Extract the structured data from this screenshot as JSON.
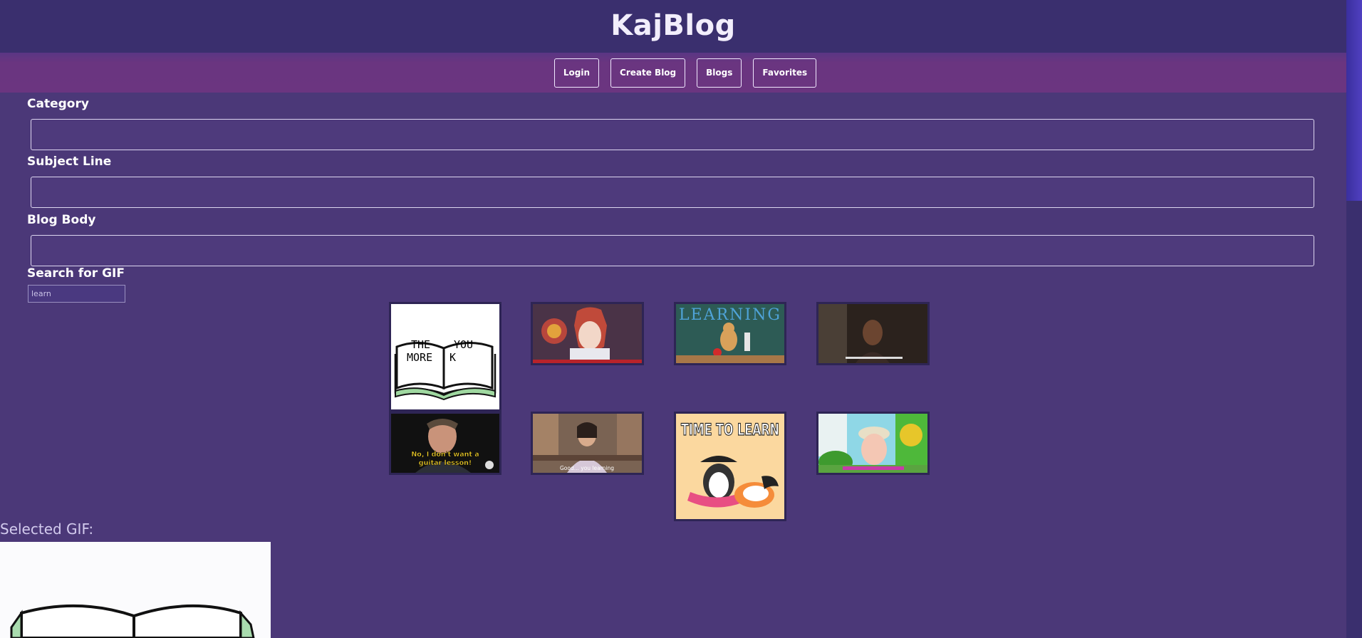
{
  "site": {
    "title": "KajBlog"
  },
  "nav": {
    "items": [
      "Login",
      "Create Blog",
      "Blogs",
      "Favorites"
    ]
  },
  "form": {
    "category_label": "Category",
    "subject_label": "Subject Line",
    "body_label": "Blog Body",
    "gif_search_label": "Search for GIF",
    "gif_search_value": "learn"
  },
  "gifs": [
    {
      "caption_lines": [
        "THE",
        "YOU",
        "MORE",
        "K"
      ]
    },
    {
      "caption": ""
    },
    {
      "caption": "LEARNING"
    },
    {
      "caption": ""
    },
    {
      "caption_lines": [
        "No, I don't want a",
        "guitar lesson!"
      ]
    },
    {
      "caption": "Good... you learning"
    },
    {
      "caption": "TIME TO LEARN"
    },
    {
      "caption": ""
    }
  ],
  "selected": {
    "label": "Selected GIF:"
  },
  "colors": {
    "background": "#4b3878",
    "header": "#3a2f6e",
    "nav": "#6b3580"
  }
}
